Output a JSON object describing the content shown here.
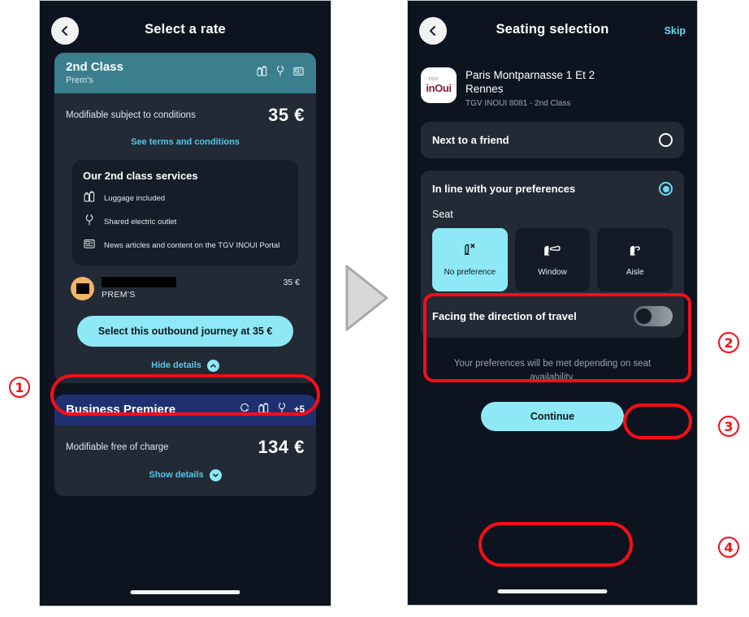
{
  "left_phone": {
    "header": {
      "title": "Select a rate",
      "back_icon": "chevron-left-icon"
    },
    "rate_cards": [
      {
        "title": "2nd Class",
        "subtitle": "Prem's",
        "header_color": "#3b7f8f",
        "icons": [
          "luggage-icon",
          "power-plug-icon",
          "newspaper-icon"
        ],
        "condition_label": "Modifiable subject to conditions",
        "price": "35 €",
        "terms_link": "See terms and conditions",
        "services_title": "Our 2nd class services",
        "services": [
          {
            "icon": "luggage-icon",
            "label": "Luggage included"
          },
          {
            "icon": "power-plug-icon",
            "label": "Shared electric outlet"
          },
          {
            "icon": "newspaper-icon",
            "label": "News articles and content on the TGV INOUI Portal"
          }
        ],
        "passenger": {
          "name_redacted": "",
          "fare": "PREM'S",
          "price": "35 €"
        },
        "cta_label": "Select this outbound journey at 35 €",
        "details_toggle": {
          "label": "Hide details",
          "icon": "chevron-up-icon"
        }
      },
      {
        "title": "Business Premiere",
        "subtitle": "",
        "header_color": "#1e3070",
        "icons": [
          "exchange-icon",
          "luggage-icon",
          "power-plug-icon"
        ],
        "extra_icons_count": "+5",
        "condition_label": "Modifiable free of charge",
        "price": "134 €",
        "details_toggle": {
          "label": "Show details",
          "icon": "chevron-down-icon"
        }
      }
    ]
  },
  "right_phone": {
    "header": {
      "title": "Seating selection",
      "back_icon": "chevron-left-icon",
      "skip_label": "Skip"
    },
    "trip": {
      "logo_small": "TGV",
      "logo_word": "inOui",
      "origin": "Paris Montparnasse 1 Et 2",
      "destination": "Rennes",
      "meta": "TGV INOUI 8081 - 2nd Class"
    },
    "options": [
      {
        "label": "Next to a friend",
        "selected": false
      },
      {
        "label": "In line with your preferences",
        "selected": true
      }
    ],
    "seat_section_label": "Seat",
    "seat_tiles": [
      {
        "label": "No preference",
        "icon": "seat-no-preference-icon",
        "selected": true
      },
      {
        "label": "Window",
        "icon": "seat-window-icon",
        "selected": false
      },
      {
        "label": "Aisle",
        "icon": "seat-aisle-icon",
        "selected": false
      }
    ],
    "facing_toggle": {
      "label": "Facing the direction of travel",
      "state": "off"
    },
    "note": "Your preferences will be met depending on seat availability.",
    "cta_label": "Continue"
  },
  "annotations": {
    "steps": [
      "1",
      "2",
      "3",
      "4"
    ],
    "highlight_color": "#fb0c16",
    "flow_arrow_icon": "triangle-right-icon"
  }
}
